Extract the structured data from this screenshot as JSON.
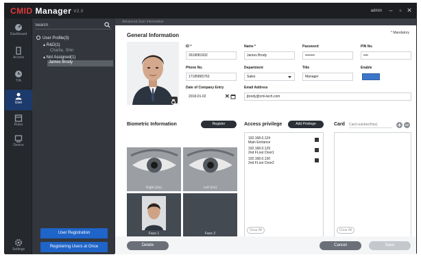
{
  "app": {
    "brand_red": "CMID",
    "brand_white": " Manager",
    "version": "V2.0",
    "user": "admin",
    "min_glyph": "–",
    "restore_glyph": "▫",
    "close_glyph": "✕"
  },
  "nav": [
    {
      "label": "Dashboard",
      "icon": "dashboard-icon"
    },
    {
      "label": "Access",
      "icon": "door-icon"
    },
    {
      "label": "T/A",
      "icon": "clock-icon"
    },
    {
      "label": "User",
      "icon": "user-icon",
      "active": true
    },
    {
      "label": "Rules",
      "icon": "calendar-icon"
    },
    {
      "label": "Device",
      "icon": "device-icon"
    },
    {
      "label": "Settings",
      "icon": "gear-icon"
    }
  ],
  "tree": {
    "search_placeholder": "Search",
    "root": "User Profile(3)",
    "group1": "▴ R&D(1)",
    "group1_child": "Charlie, Shin",
    "group2": "▴ Not Assigned(1)",
    "group2_child": "James Brody"
  },
  "sidebar_buttons": {
    "user_registration": "User Registration",
    "bulk_registration": "Registering Users at Once"
  },
  "breadcrumb": "Advanced User Information",
  "general": {
    "title": "General Information",
    "mandatory": "* Mandatory",
    "fields": {
      "id_label": "ID *",
      "id_value": "2618081932",
      "name_label": "Name *",
      "name_value": "James Brody",
      "password_label": "Password",
      "password_value": "••••••••",
      "pin_label": "PIN No.",
      "pin_value": "••••",
      "phone_label": "Phone No.",
      "phone_value": "17185865763",
      "department_label": "Department",
      "department_value": "Sales",
      "title_label": "Title",
      "title_value": "Manager",
      "enable_label": "Enable",
      "entry_label": "Date of Company Entry",
      "entry_value": "2018-01-02",
      "email_label": "Email Address",
      "email_value": "jbrody@cmi-tech.com"
    }
  },
  "biometric": {
    "title": "Biometric Information",
    "register_label": "Register",
    "cells": [
      "Right (Iris)",
      "Left (Iris)",
      "Face 1",
      "Face 2"
    ]
  },
  "access": {
    "title": "Access privilege",
    "add_label": "Add Privilege",
    "items": [
      {
        "line1": "192.168.0.124",
        "line2": "Main Entrance"
      },
      {
        "line1": "192.168.0.129",
        "line2": "2nd FLoor Door1"
      },
      {
        "line1": "192.168.0.130",
        "line2": "2nd FLoor Door2"
      }
    ],
    "clear_label": "Clear All"
  },
  "card": {
    "title": "Card",
    "placeholder": "Card number(Hex)",
    "clear_label": "Clear All"
  },
  "footer": {
    "delete_label": "Delete",
    "cancel_label": "Cancel",
    "save_label": "Save"
  },
  "colors": {
    "accent_blue": "#1f64c8",
    "brand_red": "#e23b3b",
    "nav_active": "#1c3a6b"
  }
}
